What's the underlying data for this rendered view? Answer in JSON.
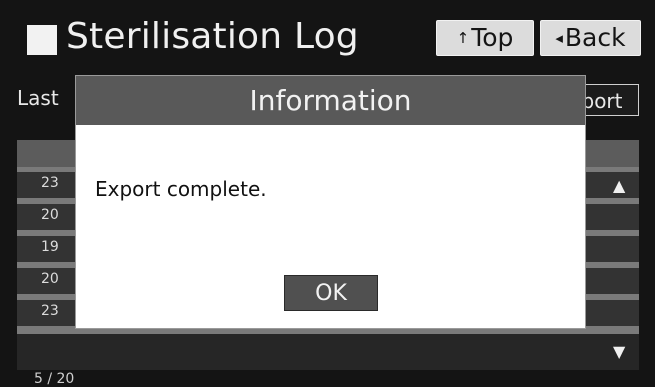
{
  "header": {
    "title": "Sterilisation Log",
    "top_button": {
      "glyph": "↑",
      "label": "Top"
    },
    "back_button": {
      "glyph": "◂",
      "label": "Back"
    }
  },
  "toolbar": {
    "last_label": "Last",
    "export_label": "port"
  },
  "table": {
    "rows": [
      "23",
      "20",
      "19",
      "20",
      "23"
    ],
    "page_indicator": "5 / 20"
  },
  "dialog": {
    "title": "Information",
    "message": "Export complete.",
    "ok_label": "OK"
  },
  "colors": {
    "screen_background": "#141414",
    "dialog_title_bar": "#595959",
    "dialog_body": "#ffffff",
    "header_button": "#dcdcdc"
  }
}
